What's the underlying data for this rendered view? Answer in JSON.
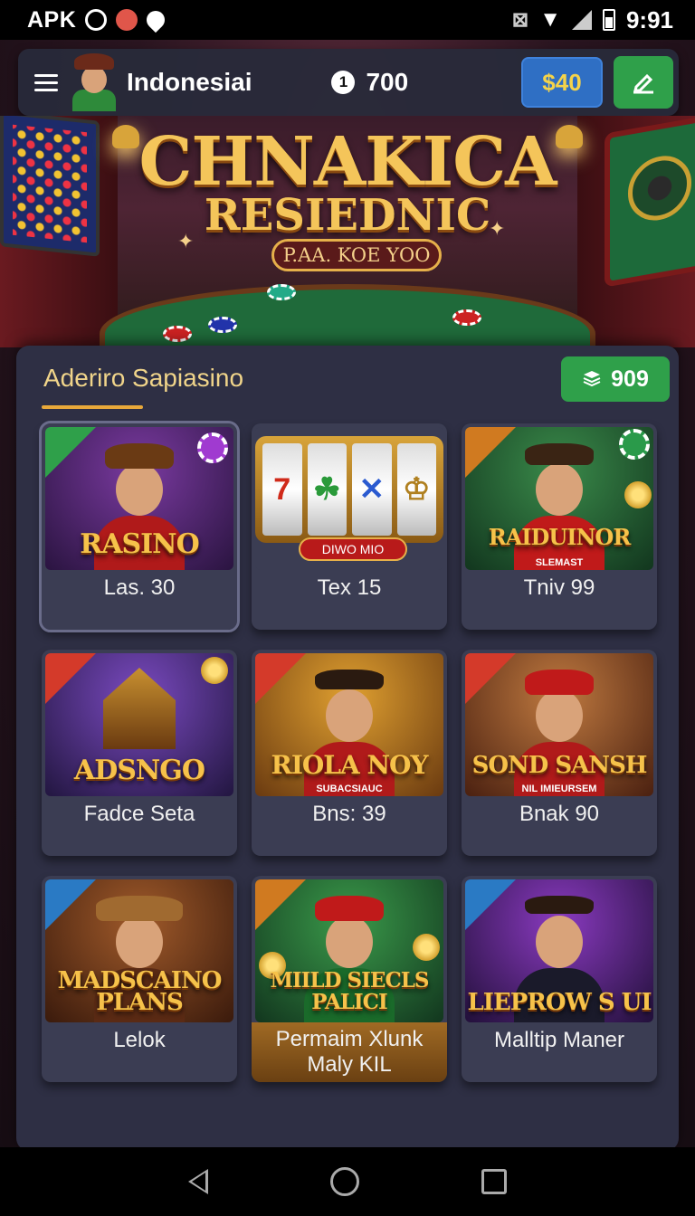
{
  "status_bar": {
    "left_text": "APK",
    "time": "9:91"
  },
  "app_bar": {
    "title": "Indonesiai",
    "coin_symbol": "1",
    "coins": "700",
    "balance_button": "$40"
  },
  "hero": {
    "title": "CHNAKICA",
    "subtitle": "RESIEDNIC",
    "badge": "P.AA. KOE YOO"
  },
  "section": {
    "title": "Aderiro Sapiasino",
    "count": "909"
  },
  "games": [
    {
      "art_title": "RASINO",
      "label": "Las. 30",
      "ribbon": "green",
      "selected": true
    },
    {
      "art_title": "",
      "slot_symbols": [
        "7",
        "☘",
        "✕",
        "♔"
      ],
      "slot_banner": "DIWO MIO",
      "label": "Tex 15"
    },
    {
      "art_title": "RAIDUINOR",
      "art_sub": "SLEMAST",
      "label": "Tniv 99",
      "ribbon": "orange"
    },
    {
      "art_title": "ADSNGO",
      "label": "Fadce Seta",
      "ribbon": "red"
    },
    {
      "art_title": "RIOLA NOY",
      "art_sub": "SUBACSIAUC",
      "label": "Bns: 39",
      "ribbon": "red"
    },
    {
      "art_title": "SOND SANSH",
      "art_sub": "NIL IMIEURSEM",
      "label": "Bnak 90",
      "ribbon": "red"
    },
    {
      "art_title": "MADSCAINO PLANS",
      "label": "Lelok",
      "ribbon": "blue"
    },
    {
      "art_title": "MIILD SIECLS PALICI",
      "label": "Permaim Xlunk Maly KIL",
      "ribbon": "orange"
    },
    {
      "art_title": "LIEPROW S UI",
      "label": "Malltip Maner",
      "ribbon": "blue"
    }
  ],
  "icons": {
    "menu": "menu-icon",
    "edit": "edit-icon",
    "stack": "stack-icon",
    "back": "back-icon",
    "home": "home-icon",
    "recent": "recent-apps-icon"
  },
  "colors": {
    "gold": "#f4c55a",
    "green": "#2fa04a",
    "blue": "#2f6fc4",
    "panel": "#2e2f44"
  }
}
